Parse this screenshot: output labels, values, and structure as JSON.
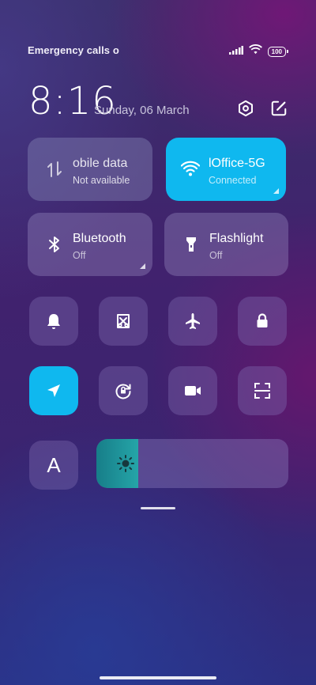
{
  "status_bar": {
    "carrier_text": "Emergency calls o",
    "battery": "100",
    "icons": [
      "signal-icon",
      "wifi-icon",
      "battery-icon"
    ]
  },
  "header": {
    "time": "8:16",
    "date": "Sunday, 06 March",
    "icons": [
      "settings-icon",
      "edit-icon"
    ]
  },
  "tiles": [
    {
      "label": "obile data",
      "sub": "Not available",
      "icon": "mobile-data-icon",
      "state": "disabled",
      "has_menu": false
    },
    {
      "label": "lOffice-5G",
      "sub": "Connected",
      "icon": "wifi-icon",
      "state": "active",
      "has_menu": true
    },
    {
      "label": "Bluetooth",
      "sub": "Off",
      "icon": "bluetooth-icon",
      "state": "off",
      "has_menu": true
    },
    {
      "label": "Flashlight",
      "sub": "Off",
      "icon": "flashlight-icon",
      "state": "off",
      "has_menu": false
    }
  ],
  "toggles": [
    {
      "icon": "bell-icon",
      "active": false
    },
    {
      "icon": "screenshot-icon",
      "active": false
    },
    {
      "icon": "airplane-icon",
      "active": false
    },
    {
      "icon": "lock-icon",
      "active": false
    },
    {
      "icon": "location-icon",
      "active": true
    },
    {
      "icon": "rotation-lock-icon",
      "active": false
    },
    {
      "icon": "video-camera-icon",
      "active": false
    },
    {
      "icon": "scanner-icon",
      "active": false
    }
  ],
  "auto_brightness": {
    "label": "A"
  },
  "brightness": {
    "level": 0.22,
    "icon": "sun-icon"
  },
  "colors": {
    "accent": "#0fb8ef",
    "brightness_fill": "#1f979b"
  }
}
